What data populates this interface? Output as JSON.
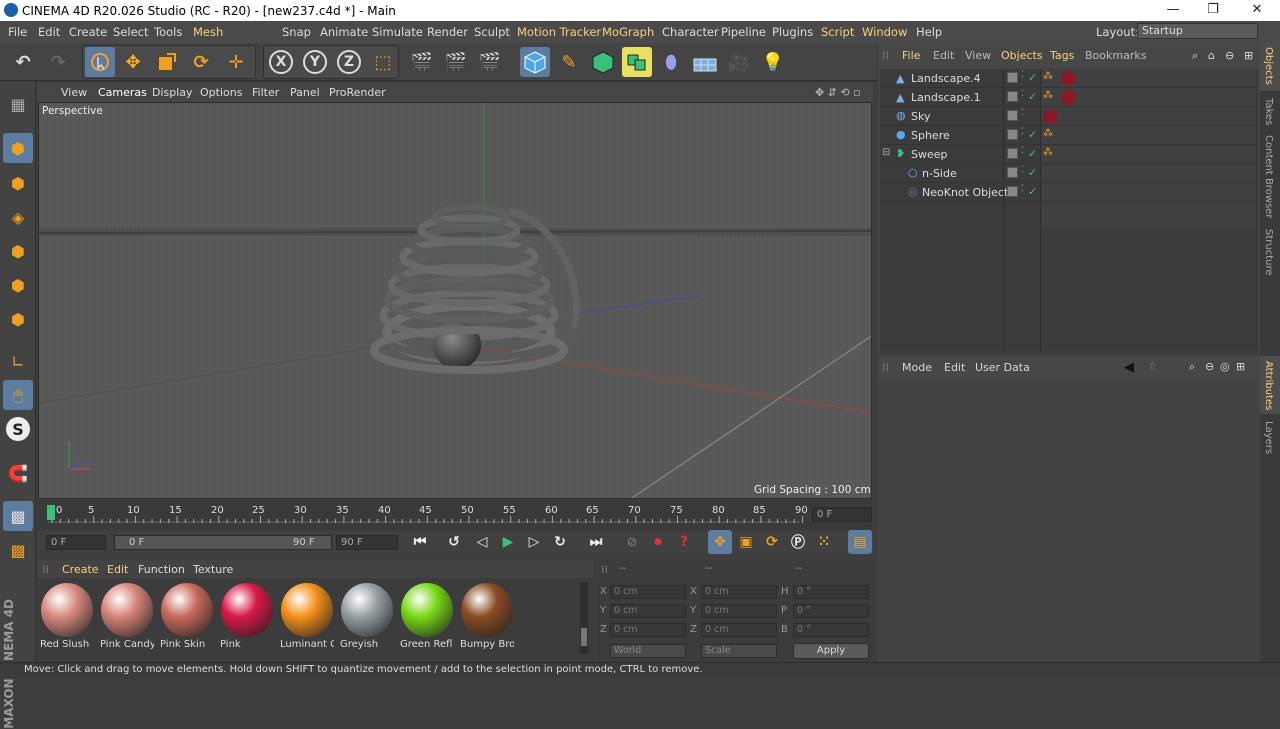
{
  "window": {
    "title": "CINEMA 4D R20.026 Studio (RC - R20) - [new237.c4d *] - Main",
    "minimize": "—",
    "restore": "❐",
    "close": "✕"
  },
  "menubar": {
    "items": [
      "File",
      "Edit",
      "Create",
      "Select",
      "Tools",
      "Mesh",
      "Snap",
      "Animate",
      "Simulate",
      "Render",
      "Sculpt",
      "Motion Tracker",
      "MoGraph",
      "Character",
      "Pipeline",
      "Plugins",
      "Script",
      "Window",
      "Help"
    ],
    "layout_label": "Layout:",
    "layout_value": "Startup"
  },
  "toolbar": {
    "icons": [
      "undo-icon",
      "redo-icon",
      "live-selection-icon",
      "move-icon",
      "scale-icon",
      "rotate-icon",
      "move-plus-icon",
      "x-axis-icon",
      "y-axis-icon",
      "z-axis-icon",
      "coordinate-system-icon",
      "render-view-icon",
      "render-picture-viewer-icon",
      "render-settings-icon",
      "cube-icon",
      "pen-icon",
      "subdivision-icon",
      "array-icon",
      "deformer-icon",
      "floor-icon",
      "camera-icon",
      "light-icon"
    ],
    "axis_x": "X",
    "axis_y": "Y",
    "axis_z": "Z"
  },
  "viewport": {
    "menu": [
      "View",
      "Cameras",
      "Display",
      "Options",
      "Filter",
      "Panel",
      "ProRender"
    ],
    "label": "Perspective",
    "grid_spacing": "Grid Spacing : 100 cm"
  },
  "timeline": {
    "ticks": [
      "0",
      "5",
      "10",
      "15",
      "20",
      "25",
      "30",
      "35",
      "40",
      "45",
      "50",
      "55",
      "60",
      "65",
      "70",
      "75",
      "80",
      "85",
      "90"
    ],
    "current_frame": "0 F",
    "start_field": "0 F",
    "range_start": "0 F",
    "range_end": "90 F",
    "end_field": "90 F"
  },
  "materials": {
    "menu": [
      "Create",
      "Edit",
      "Function",
      "Texture"
    ],
    "items": [
      {
        "label": "Red Slush",
        "color": "#d88a80"
      },
      {
        "label": "Pink Candy",
        "color": "#d8847a"
      },
      {
        "label": "Pink Skin",
        "color": "#c86a5c"
      },
      {
        "label": "Pink",
        "color": "#d81848"
      },
      {
        "label": "Luminant C",
        "color": "#f5901a"
      },
      {
        "label": "Greyish",
        "color": "#98a0a4"
      },
      {
        "label": "Green Refl",
        "color": "#7ad818"
      },
      {
        "label": "Bumpy Bro",
        "color": "#8a4c24"
      }
    ]
  },
  "coords": {
    "header_left": "--",
    "header_mid": "--",
    "header_right": "--",
    "rows": [
      {
        "a": "X",
        "av": "0 cm",
        "b": "X",
        "bv": "0 cm",
        "c": "H",
        "cv": "0 °"
      },
      {
        "a": "Y",
        "av": "0 cm",
        "b": "Y",
        "bv": "0 cm",
        "c": "P",
        "cv": "0 °"
      },
      {
        "a": "Z",
        "av": "0 cm",
        "b": "Z",
        "bv": "0 cm",
        "c": "B",
        "cv": "0 °"
      }
    ],
    "world": "World",
    "scale": "Scale",
    "apply": "Apply"
  },
  "objects": {
    "menu": [
      "File",
      "Edit",
      "View",
      "Objects",
      "Tags",
      "Bookmarks"
    ],
    "items": [
      {
        "name": "Landscape.4",
        "indent": 0
      },
      {
        "name": "Landscape.1",
        "indent": 0
      },
      {
        "name": "Sky",
        "indent": 0
      },
      {
        "name": "Sphere",
        "indent": 0
      },
      {
        "name": "Sweep",
        "indent": 0
      },
      {
        "name": "n-Side",
        "indent": 1
      },
      {
        "name": "NeoKnot Object",
        "indent": 1
      }
    ]
  },
  "attributes": {
    "menu": [
      "Mode",
      "Edit",
      "User Data"
    ]
  },
  "sidetabs": {
    "right_top": [
      "Objects",
      "Takes",
      "Content Browser",
      "Structure"
    ],
    "right_bottom": [
      "Attributes",
      "Layers"
    ]
  },
  "branding": "MAXON CINEMA 4D",
  "status": "Move: Click and drag to move elements. Hold down SHIFT to quantize movement / add to the selection in point mode, CTRL to remove."
}
